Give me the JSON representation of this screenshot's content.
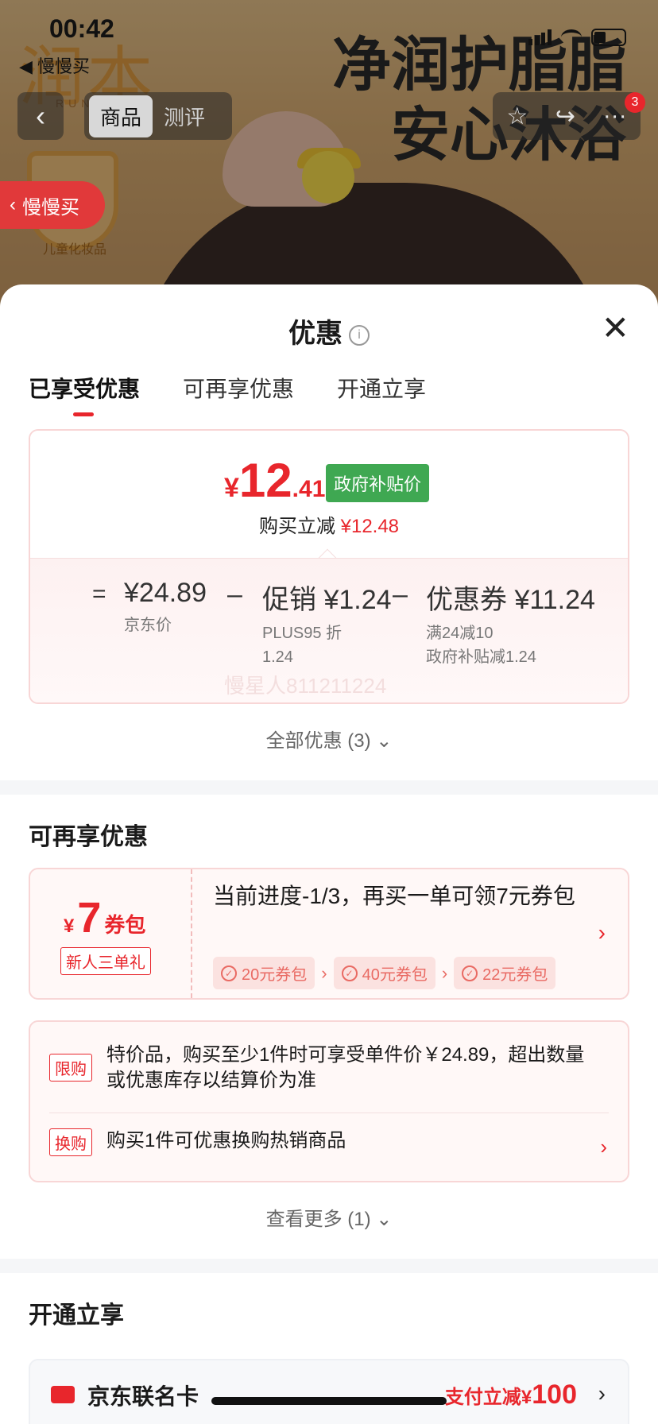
{
  "status_bar": {
    "time": "00:42",
    "back_app": "◀ 慢慢买"
  },
  "background": {
    "brand": "润本",
    "brand_sub": "RUNBEN",
    "headline_line1": "净润护脂脂",
    "headline_line2": "安心沐浴",
    "shield_caption": "儿童化妆品"
  },
  "nav": {
    "back_icon": "‹",
    "segments": [
      "商品",
      "测评"
    ],
    "right_icons": [
      "☆",
      "↪",
      "···"
    ],
    "badge_count": "3"
  },
  "float_pill": {
    "label": "慢慢买",
    "icon": "‹"
  },
  "sheet": {
    "title": "优惠",
    "info_icon": "i",
    "close_icon": "✕",
    "tabs": [
      "已享受优惠",
      "可再享优惠",
      "开通立享"
    ],
    "price": {
      "currency": "¥",
      "integer": "12",
      "decimal": ".41",
      "tag": "政府补贴价",
      "reduce_label": "购买立减",
      "reduce_value": "¥12.48"
    },
    "breakdown": {
      "eq": "=",
      "jd_price": "¥24.89",
      "jd_label": "京东价",
      "minus": "–",
      "promo": "促销 ¥1.24",
      "promo_note_1": "PLUS95 折",
      "promo_note_2": "1.24",
      "coupon": "优惠券 ¥11.24",
      "coupon_note_1": "满24减10",
      "coupon_note_2": "政府补贴减1.24",
      "watermark": "慢星人811211224"
    },
    "all_offers": "全部优惠 (3) ⌄",
    "section2_title": "可再享优惠",
    "coupon_pack": {
      "currency": "¥",
      "amount": "7",
      "unit": "券包",
      "tag": "新人三单礼",
      "text": "当前进度-1/3，再买一单可领7元券包",
      "chips": [
        "20元券包",
        "40元券包",
        "22元券包"
      ],
      "arrow": "›"
    },
    "rules": [
      {
        "tag": "限购",
        "text": "特价品，购买至少1件时可享受单件价￥24.89，超出数量或优惠库存以结算价为准"
      },
      {
        "tag": "换购",
        "text": "购买1件可优惠换购热销商品"
      }
    ],
    "more": "查看更多 (1) ⌄",
    "section3_title": "开通立享",
    "card": {
      "name": "京东联名卡",
      "pay_prefix": "支付立减¥",
      "pay_amount": "100",
      "arrow": "›"
    }
  }
}
